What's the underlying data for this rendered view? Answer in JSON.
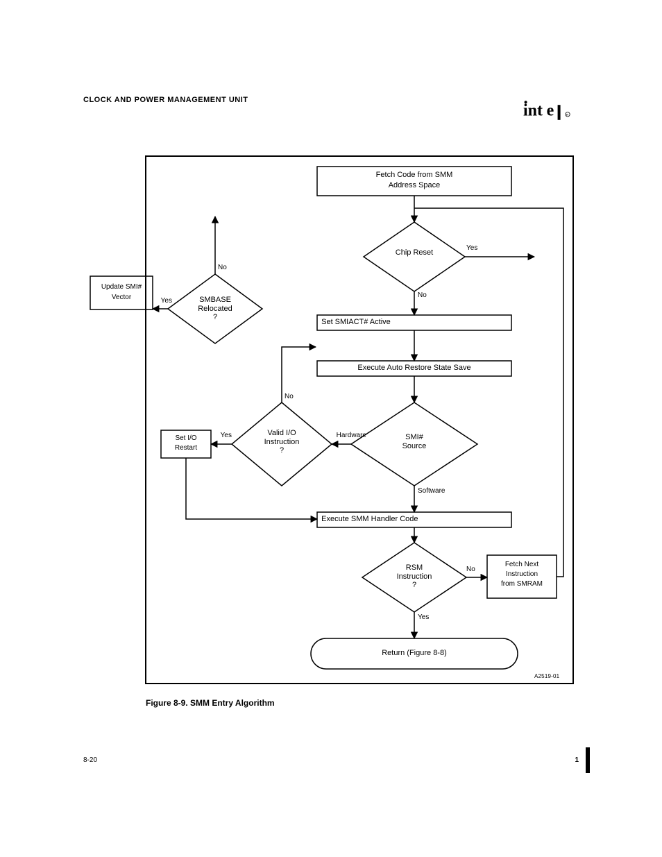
{
  "page": {
    "header": "CLOCK AND POWER MANAGEMENT UNIT",
    "page_number": "8-20",
    "rev": "1",
    "figure_caption": "Figure 8-9.  SMM Entry Algorithm",
    "source_note": "A2519-01"
  },
  "flow": {
    "start": {
      "line1": "Fetch Code from SMM",
      "line2": "Address Space"
    },
    "d_chip_reset": {
      "text": "Chip Reset",
      "yes": "Yes",
      "no": "No"
    },
    "p_set_smiact": "  Set SMIACT# Active",
    "p_save_state": "Execute Auto Restore State Save",
    "d_smi_source": {
      "text": "SMI#\nSource",
      "hw": "Hardware",
      "sw": "Software"
    },
    "d_valid_io": {
      "text": "Valid I/O\nInstruction\n?",
      "yes": "Yes",
      "no": "No"
    },
    "p_restart": {
      "line1": "Set I/O",
      "line2": "Restart"
    },
    "p_handler": "  Execute SMM Handler Code",
    "d_rsm": {
      "text": "RSM\nInstruction\n?",
      "yes": "Yes",
      "no": "No"
    },
    "p_fetch_smram": {
      "line1": "Fetch Next",
      "line2": "Instruction",
      "line3": "from SMRAM"
    },
    "term": "Return (Figure 8-8)",
    "d_smbase": {
      "text": "SMBASE\nRelocated\n?",
      "yes": "Yes",
      "no": "No"
    },
    "p_update_smi": {
      "line1": "Update SMI#",
      "line2": "Vector"
    }
  }
}
